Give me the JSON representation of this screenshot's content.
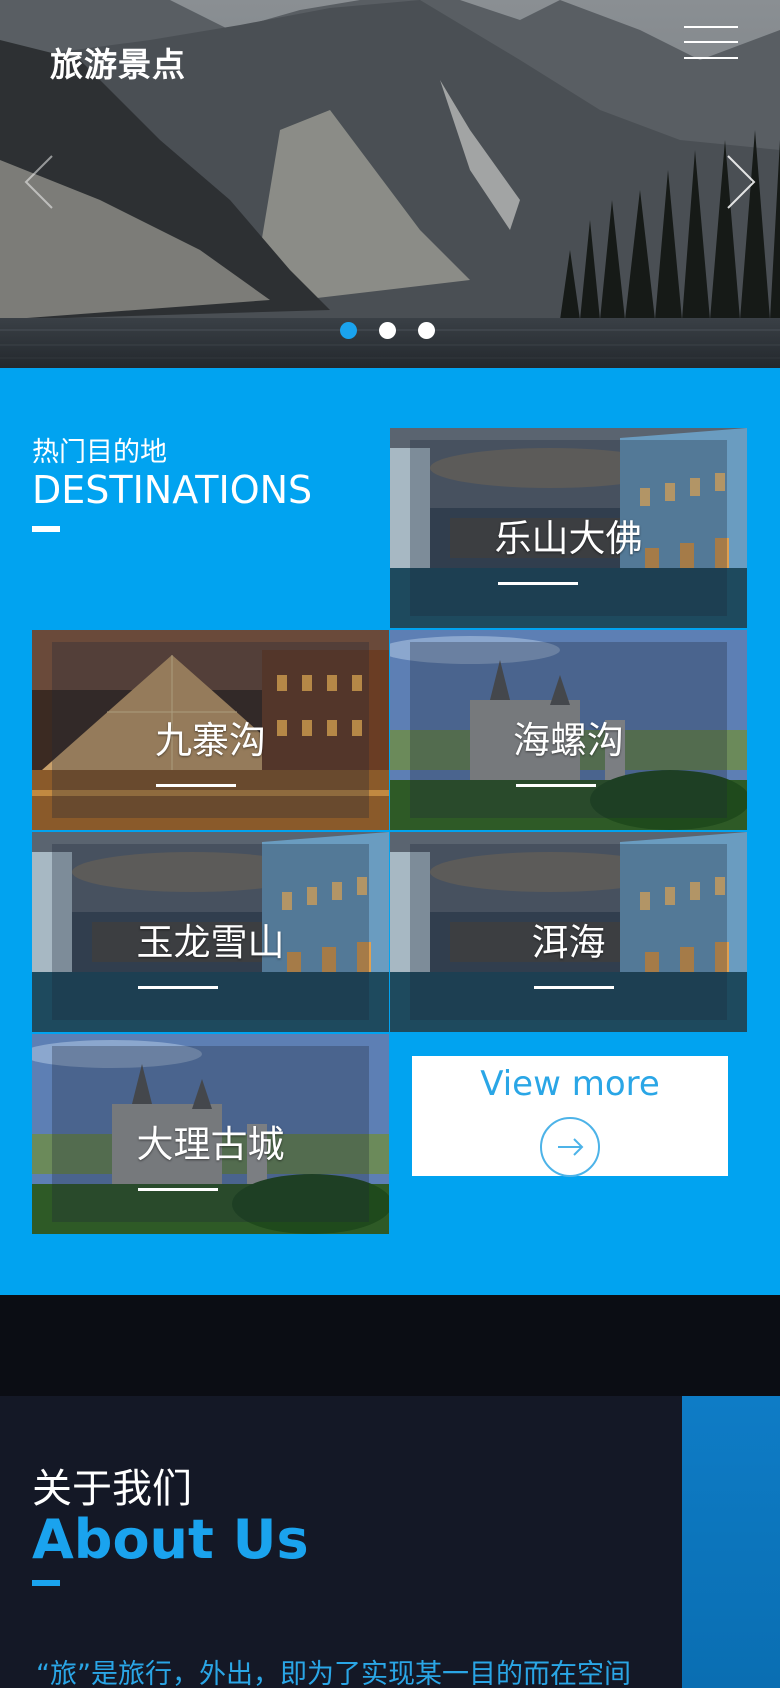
{
  "header": {
    "logo": "旅游景点",
    "menu_icon": "hamburger-menu-icon",
    "prev_icon": "chevron-left-icon",
    "next_icon": "chevron-right-icon"
  },
  "slider": {
    "dots": 3,
    "active_dot": 1
  },
  "destinations": {
    "title_zh": "热门目的地",
    "title_en": "DESTINATIONS",
    "items": [
      {
        "label": "乐山大佛",
        "image": "venice-canal"
      },
      {
        "label": "九寨沟",
        "image": "louvre-pyramid-night"
      },
      {
        "label": "海螺沟",
        "image": "castle-green-hills"
      },
      {
        "label": "玉龙雪山",
        "image": "venice-canal"
      },
      {
        "label": "洱海",
        "image": "venice-canal"
      },
      {
        "label": "大理古城",
        "image": "castle-green-hills"
      }
    ],
    "view_more": "View more",
    "view_more_icon": "arrow-right-icon"
  },
  "about": {
    "title_zh": "关于我们",
    "title_en": "About Us",
    "text": "“旅”是旅行，外出，即为了实现某一目的而在空间"
  },
  "colors": {
    "accent": "#01a3f0",
    "dark": "#141826",
    "white": "#ffffff"
  }
}
